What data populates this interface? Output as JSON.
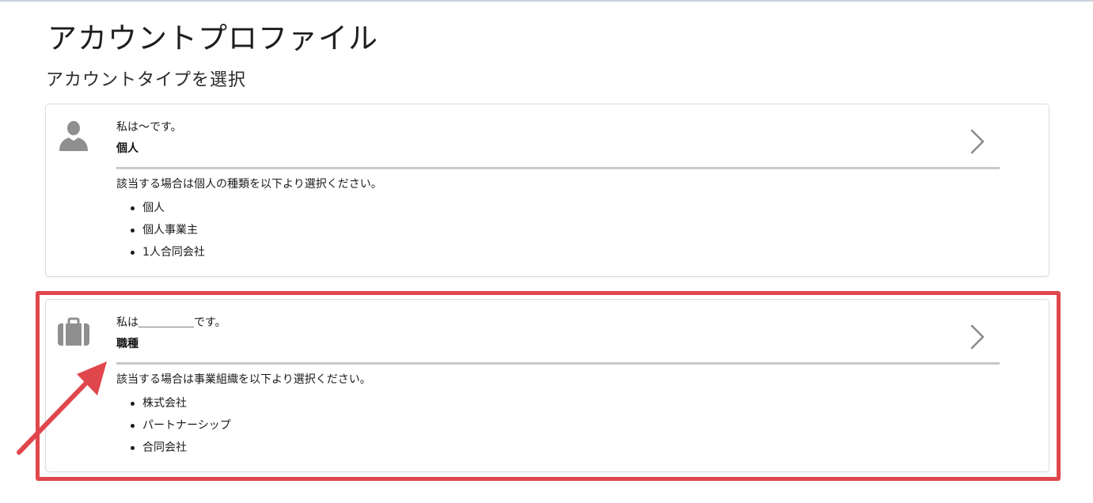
{
  "page": {
    "title": "アカウントプロファイル",
    "subtitle": "アカウントタイプを選択"
  },
  "cards": [
    {
      "icon": "person-icon",
      "lead": "私は～です。",
      "type": "個人",
      "description": "該当する場合は個人の種類を以下より選択ください。",
      "options": [
        "個人",
        "個人事業主",
        "1人合同会社"
      ]
    },
    {
      "icon": "briefcase-icon",
      "lead": "私は＿＿＿＿＿です。",
      "type": "職種",
      "description": "該当する場合は事業組織を以下より選択ください。",
      "options": [
        "株式会社",
        "パートナーシップ",
        "合同会社"
      ]
    }
  ],
  "colors": {
    "highlight": "#e0474c",
    "icon": "#8f8f8f",
    "chevron": "#8a8a8a",
    "divider": "#c8c8c8",
    "card_border": "#dcdcdc"
  }
}
